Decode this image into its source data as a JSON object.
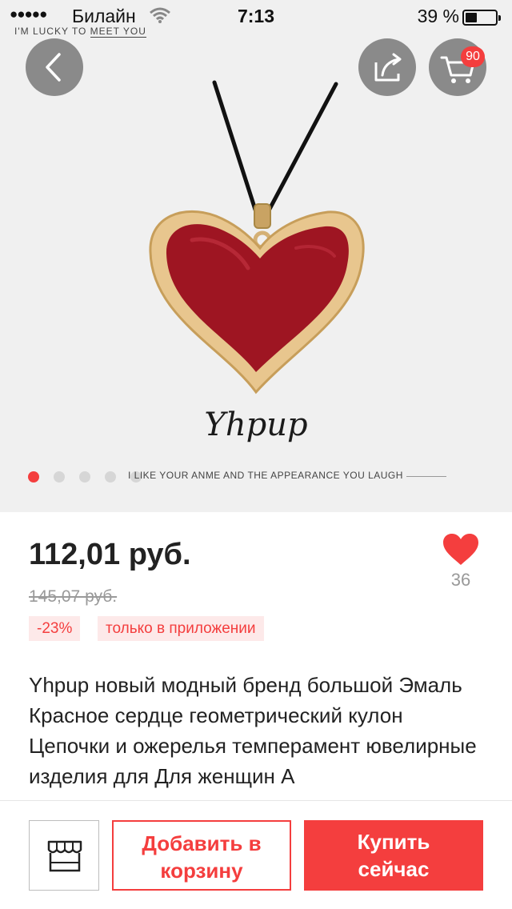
{
  "status_bar": {
    "signal_dots": "●●●●●",
    "carrier": "Билайн",
    "time": "7:13",
    "battery": "39 %"
  },
  "brand_tag": {
    "part1": "I'M LUCKY TO ",
    "part2": "MEET YOU"
  },
  "header": {
    "back_icon": "chevron-left-icon",
    "share_icon": "share-icon",
    "cart_icon": "cart-icon",
    "cart_count": "90"
  },
  "gallery": {
    "logo_word": "Yhpup",
    "slogan": "I LIKE YOUR  ANME AND THE APPEARANCE YOU LAUGH",
    "slide_count": 5,
    "active_slide": 1
  },
  "product": {
    "price": "112,01 руб.",
    "old_price": "145,07 руб.",
    "likes": "36",
    "discount_tag": "-23%",
    "app_only_tag": "только в приложении",
    "title": "Yhpup новый модный бренд большой Эмаль Красное сердце геометрический кулон Цепочки и ожерелья темперамент ювелирные изделия для Для женщин A"
  },
  "actions": {
    "store_icon": "storefront-icon",
    "add_to_cart_line1": "Добавить в",
    "add_to_cart_line2": "корзину",
    "buy_now_line1": "Купить",
    "buy_now_line2": "сейчас"
  },
  "colors": {
    "accent": "#f43e3e",
    "tag_bg": "#fde9e9",
    "hero_bg": "#f0f0f0",
    "muted_text": "#9a9a9a"
  }
}
